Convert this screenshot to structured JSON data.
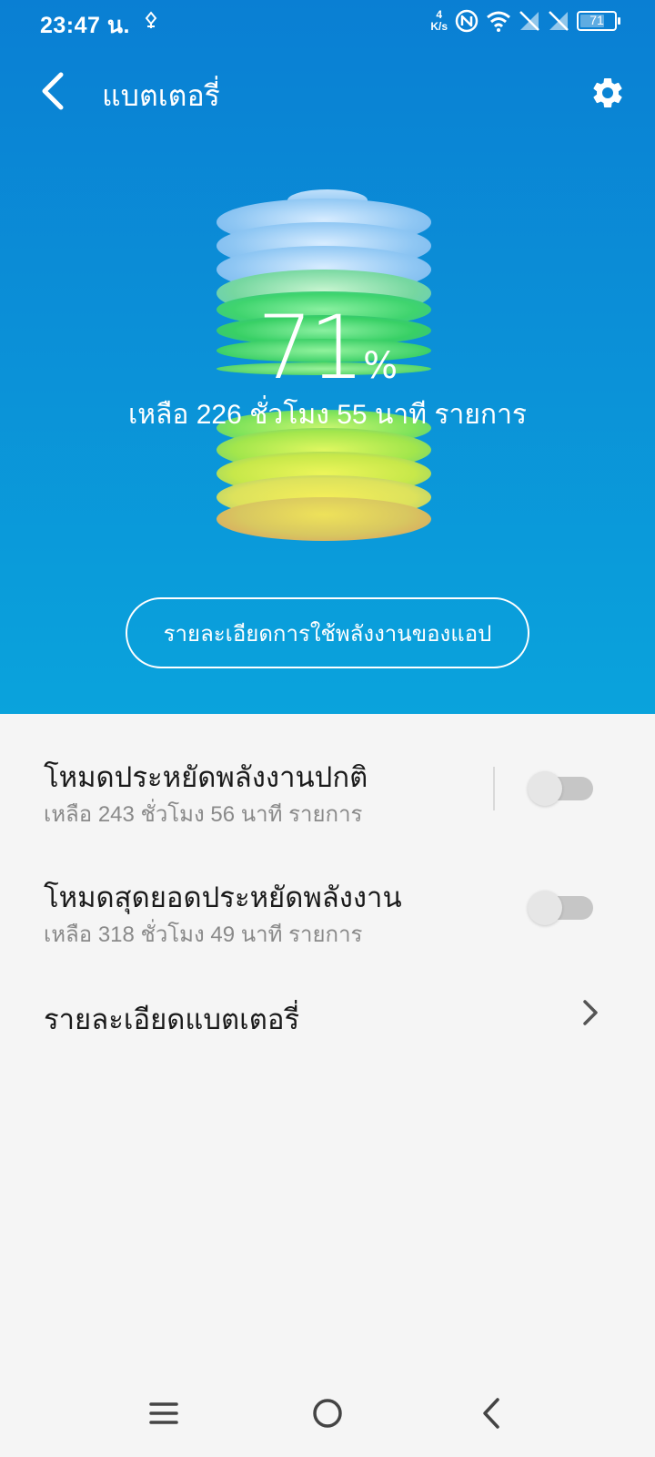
{
  "status_bar": {
    "time": "23:47 น.",
    "net_speed_top": "4",
    "net_speed_unit": "K/s",
    "battery_level": "71",
    "battery_fraction": 0.71,
    "icons": [
      "notification-icon",
      "nfc-icon",
      "wifi-icon",
      "no-sim-icon",
      "no-sim-icon",
      "battery-icon"
    ]
  },
  "app_bar": {
    "title": "แบตเตอรี่",
    "back_icon": "back-arrow-icon",
    "settings_icon": "gear-icon"
  },
  "battery": {
    "percent": "71",
    "percent_sign": "%",
    "remaining": "เหลือ 226 ชั่วโมง 55 นาที รายการ",
    "usage_button": "รายละเอียดการใช้พลังงานของแอป"
  },
  "list": {
    "power_saving": {
      "title": "โหมดประหยัดพลังงานปกติ",
      "subtitle": "เหลือ 243 ชั่วโมง 56 นาที รายการ",
      "enabled": false
    },
    "ultra_saving": {
      "title": "โหมดสุดยอดประหยัดพลังงาน",
      "subtitle": "เหลือ 318 ชั่วโมง 49 นาที รายการ",
      "enabled": false
    },
    "battery_details": {
      "title": "รายละเอียดแบตเตอรี่"
    }
  },
  "nav_bar": {
    "icons": [
      "menu-icon",
      "home-icon",
      "back-icon"
    ]
  },
  "colors": {
    "hero_top": "#0a7fd3",
    "hero_bottom": "#0aa3dc",
    "background": "#f5f5f5",
    "toggle_track": "#c6c6c6"
  }
}
